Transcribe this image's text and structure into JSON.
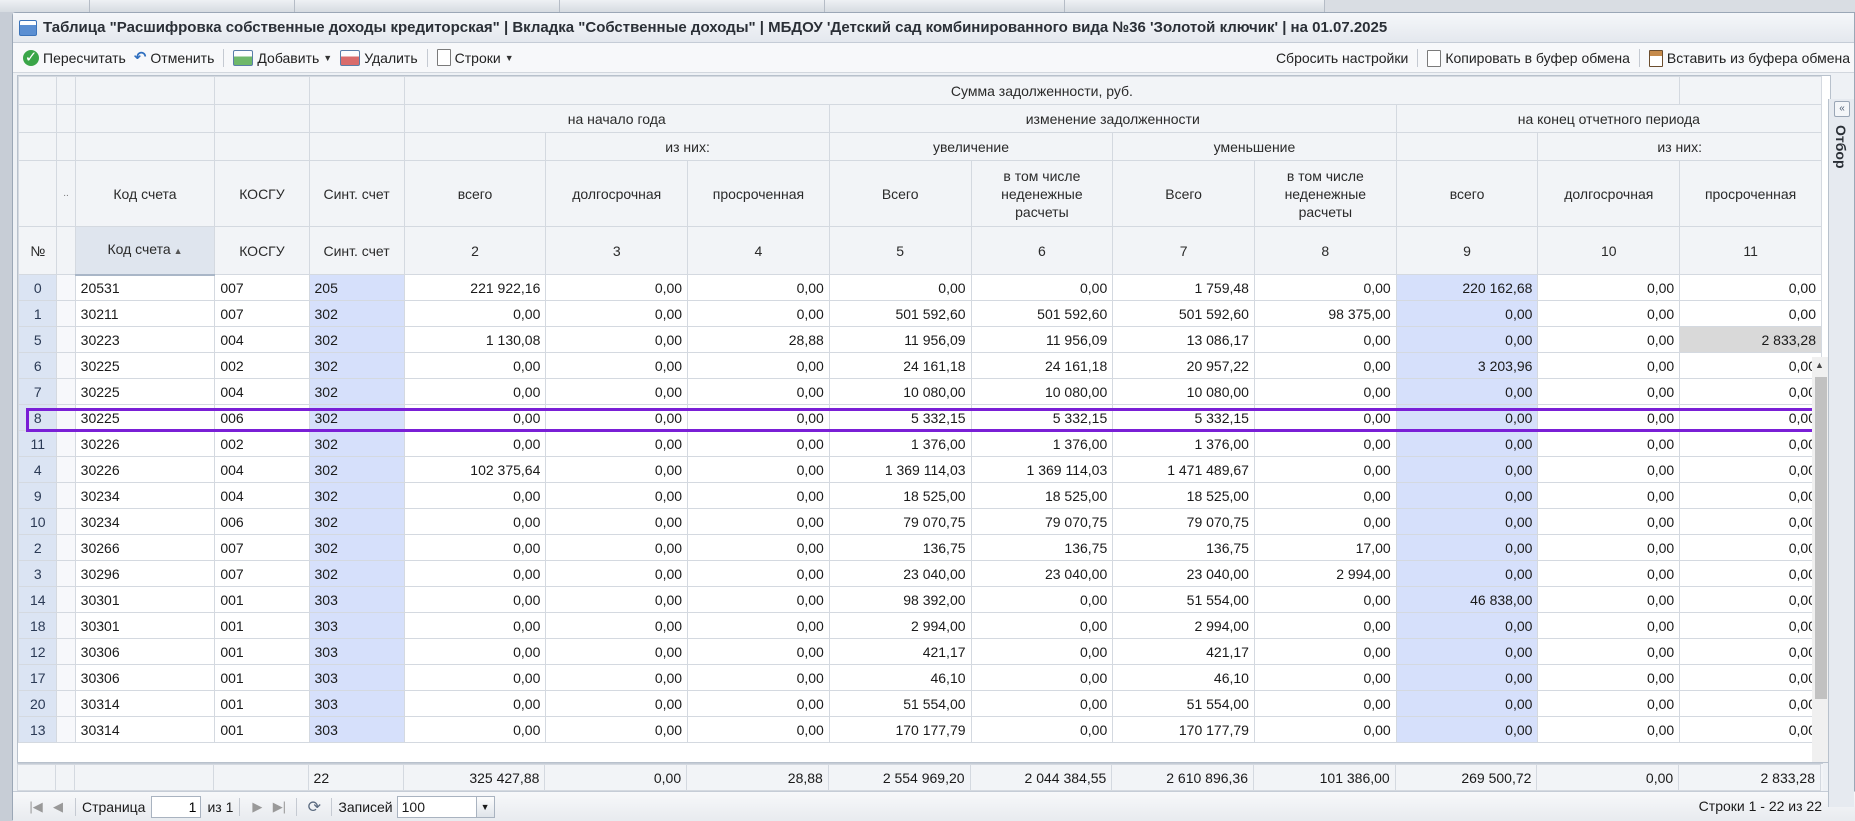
{
  "window": {
    "title": "Таблица \"Расшифровка собственные доходы кредиторская\" | Вкладка \"Собственные доходы\" | МБДОУ 'Детский сад комбинированного вида №36 'Золотой ключик' | на 01.07.2025"
  },
  "toolbar": {
    "recalc": "Пересчитать",
    "cancel": "Отменить",
    "add": "Добавить",
    "delete": "Удалить",
    "rows": "Строки",
    "reset": "Сбросить настройки",
    "copy": "Копировать в буфер обмена",
    "paste": "Вставить из буфера обмена"
  },
  "side_panel": {
    "label": "Отбор"
  },
  "header": {
    "sum": "Сумма задолженности, руб.",
    "start_year": "на начало года",
    "change": "изменение задолженности",
    "end_period": "на конец отчетного периода",
    "of_them": "из них:",
    "increase": "увеличение",
    "decrease": "уменьшение",
    "dots": "..",
    "names": {
      "account": "Код счета",
      "kosgu": "КОСГУ",
      "sint": "Синт. счет",
      "total_lc": "всего",
      "long": "долгосрочная",
      "overdue": "просроченная",
      "total_uc": "Всего",
      "nonmonetary": "в том числе неденежные расчеты"
    },
    "numbers": {
      "no": "№",
      "account": "Код счета",
      "kosgu": "КОСГУ",
      "sint": "Синт. счет",
      "c2": "2",
      "c3": "3",
      "c4": "4",
      "c5": "5",
      "c6": "6",
      "c7": "7",
      "c8": "8",
      "c9": "9",
      "c10": "10",
      "c11": "11"
    }
  },
  "rows": [
    [
      "0",
      "20531",
      "007",
      "205",
      "221 922,16",
      "0,00",
      "0,00",
      "0,00",
      "0,00",
      "1 759,48",
      "0,00",
      "220 162,68",
      "0,00",
      "0,00"
    ],
    [
      "1",
      "30211",
      "007",
      "302",
      "0,00",
      "0,00",
      "0,00",
      "501 592,60",
      "501 592,60",
      "501 592,60",
      "98 375,00",
      "0,00",
      "0,00",
      "0,00"
    ],
    [
      "5",
      "30223",
      "004",
      "302",
      "1 130,08",
      "0,00",
      "28,88",
      "11 956,09",
      "11 956,09",
      "13 086,17",
      "0,00",
      "0,00",
      "0,00",
      "2 833,28"
    ],
    [
      "6",
      "30225",
      "002",
      "302",
      "0,00",
      "0,00",
      "0,00",
      "24 161,18",
      "24 161,18",
      "20 957,22",
      "0,00",
      "3 203,96",
      "0,00",
      "0,00"
    ],
    [
      "7",
      "30225",
      "004",
      "302",
      "0,00",
      "0,00",
      "0,00",
      "10 080,00",
      "10 080,00",
      "10 080,00",
      "0,00",
      "0,00",
      "0,00",
      "0,00"
    ],
    [
      "8",
      "30225",
      "006",
      "302",
      "0,00",
      "0,00",
      "0,00",
      "5 332,15",
      "5 332,15",
      "5 332,15",
      "0,00",
      "0,00",
      "0,00",
      "0,00"
    ],
    [
      "11",
      "30226",
      "002",
      "302",
      "0,00",
      "0,00",
      "0,00",
      "1 376,00",
      "1 376,00",
      "1 376,00",
      "0,00",
      "0,00",
      "0,00",
      "0,00"
    ],
    [
      "4",
      "30226",
      "004",
      "302",
      "102 375,64",
      "0,00",
      "0,00",
      "1 369 114,03",
      "1 369 114,03",
      "1 471 489,67",
      "0,00",
      "0,00",
      "0,00",
      "0,00"
    ],
    [
      "9",
      "30234",
      "004",
      "302",
      "0,00",
      "0,00",
      "0,00",
      "18 525,00",
      "18 525,00",
      "18 525,00",
      "0,00",
      "0,00",
      "0,00",
      "0,00"
    ],
    [
      "10",
      "30234",
      "006",
      "302",
      "0,00",
      "0,00",
      "0,00",
      "79 070,75",
      "79 070,75",
      "79 070,75",
      "0,00",
      "0,00",
      "0,00",
      "0,00"
    ],
    [
      "2",
      "30266",
      "007",
      "302",
      "0,00",
      "0,00",
      "0,00",
      "136,75",
      "136,75",
      "136,75",
      "17,00",
      "0,00",
      "0,00",
      "0,00"
    ],
    [
      "3",
      "30296",
      "007",
      "302",
      "0,00",
      "0,00",
      "0,00",
      "23 040,00",
      "23 040,00",
      "23 040,00",
      "2 994,00",
      "0,00",
      "0,00",
      "0,00"
    ],
    [
      "14",
      "30301",
      "001",
      "303",
      "0,00",
      "0,00",
      "0,00",
      "98 392,00",
      "0,00",
      "51 554,00",
      "0,00",
      "46 838,00",
      "0,00",
      "0,00"
    ],
    [
      "18",
      "30301",
      "001",
      "303",
      "0,00",
      "0,00",
      "0,00",
      "2 994,00",
      "0,00",
      "2 994,00",
      "0,00",
      "0,00",
      "0,00",
      "0,00"
    ],
    [
      "12",
      "30306",
      "001",
      "303",
      "0,00",
      "0,00",
      "0,00",
      "421,17",
      "0,00",
      "421,17",
      "0,00",
      "0,00",
      "0,00",
      "0,00"
    ],
    [
      "17",
      "30306",
      "001",
      "303",
      "0,00",
      "0,00",
      "0,00",
      "46,10",
      "0,00",
      "46,10",
      "0,00",
      "0,00",
      "0,00",
      "0,00"
    ],
    [
      "20",
      "30314",
      "001",
      "303",
      "0,00",
      "0,00",
      "0,00",
      "51 554,00",
      "0,00",
      "51 554,00",
      "0,00",
      "0,00",
      "0,00",
      "0,00"
    ],
    [
      "13",
      "30314",
      "001",
      "303",
      "0,00",
      "0,00",
      "0,00",
      "170 177,79",
      "0,00",
      "170 177,79",
      "0,00",
      "0,00",
      "0,00",
      "0,00"
    ]
  ],
  "highlighted_row_index": 2,
  "totals": [
    "",
    "",
    "",
    "22",
    "325 427,88",
    "0,00",
    "28,88",
    "2 554 969,20",
    "2 044 384,55",
    "2 610 896,36",
    "101 386,00",
    "269 500,72",
    "0,00",
    "2 833,28"
  ],
  "pager": {
    "page_label": "Страница",
    "page_value": "1",
    "of_label": "из 1",
    "records_label": "Записей",
    "records_value": "100",
    "rows_info": "Строки 1 - 22 из 22"
  },
  "colors": {
    "highlight_border": "#7a1fd6",
    "sint_bg": "#d6e0fb",
    "rownum_bg": "#dbe4f3"
  }
}
